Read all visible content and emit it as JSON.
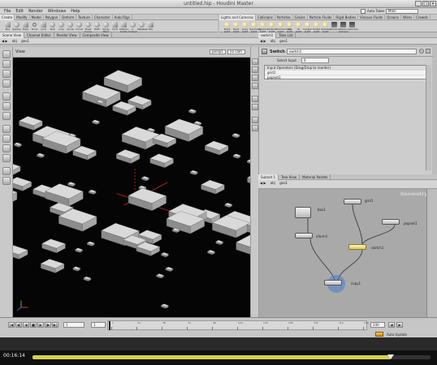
{
  "window": {
    "title": "untitled.hip - Houdini Master"
  },
  "menu": [
    "File",
    "Edit",
    "Render",
    "Windows",
    "Help"
  ],
  "menu_right": {
    "checkbox_label": "Auto Takes",
    "field_value": "Main"
  },
  "shelf_tabs_left": [
    "Create",
    "Modify",
    "Model",
    "Polygon",
    "Deform",
    "Texture",
    "Character",
    "Auto Rigs"
  ],
  "shelf_tabs_right": [
    "Lights and Cameras",
    "Collisions",
    "Particles",
    "Grains",
    "Particle Fluids",
    "Rigid Bodies",
    "Viscous Fluids",
    "Oceans",
    "Wires",
    "Crowds",
    "Drive Simulation"
  ],
  "shelf_tools_left": [
    {
      "label": "Box",
      "icon": "box-tool-icon",
      "shape": "cube"
    },
    {
      "label": "Sphere",
      "icon": "sphere-tool-icon",
      "shape": "sphere"
    },
    {
      "label": "Tube",
      "icon": "tube-tool-icon",
      "shape": "cube"
    },
    {
      "label": "Torus",
      "icon": "torus-tool-icon",
      "shape": "tor"
    },
    {
      "label": "Grid",
      "icon": "grid-tool-icon",
      "shape": "cube"
    },
    {
      "label": "Null",
      "icon": "null-tool-icon",
      "shape": "sphere"
    },
    {
      "label": "Line",
      "icon": "line-tool-icon",
      "shape": "sphere"
    },
    {
      "label": "Circle",
      "icon": "circle-tool-icon",
      "shape": "sphere"
    },
    {
      "label": "Curve",
      "icon": "curve-tool-icon",
      "shape": "sphere"
    },
    {
      "label": "Draw Curve",
      "icon": "draw-curve-tool-icon",
      "shape": "sphere"
    },
    {
      "label": "Path",
      "icon": "path-tool-icon",
      "shape": "sphere"
    },
    {
      "label": "Spray Paint",
      "icon": "spray-paint-tool-icon",
      "shape": "sphere"
    },
    {
      "label": "Font",
      "icon": "font-tool-icon",
      "shape": "cube"
    },
    {
      "label": "Platonic Solids",
      "icon": "platonic-tool-icon",
      "shape": "cube"
    },
    {
      "label": "L-System",
      "icon": "lsystem-tool-icon",
      "shape": "sphere"
    },
    {
      "label": "Metaball",
      "icon": "metaball-tool-icon",
      "shape": "sphere"
    },
    {
      "label": "File",
      "icon": "file-tool-icon",
      "shape": "cube"
    }
  ],
  "shelf_tools_right": [
    {
      "label": "Point Light",
      "icon": "point-light-icon",
      "shape": "lit"
    },
    {
      "label": "Spot Light",
      "icon": "spot-light-icon",
      "shape": "lit"
    },
    {
      "label": "Area Light",
      "icon": "area-light-icon",
      "shape": "lit"
    },
    {
      "label": "Geometry Light",
      "icon": "geometry-light-icon",
      "shape": "lit"
    },
    {
      "label": "Volume Light",
      "icon": "volume-light-icon",
      "shape": "lit"
    },
    {
      "label": "Distant Light",
      "icon": "distant-light-icon",
      "shape": "lit"
    },
    {
      "label": "Environment Light",
      "icon": "env-light-icon",
      "shape": "lit"
    },
    {
      "label": "Sky Light",
      "icon": "sky-light-icon",
      "shape": "lit"
    },
    {
      "label": "GI Light",
      "icon": "gi-light-icon",
      "shape": "lit"
    },
    {
      "label": "Caustic Light",
      "icon": "caustic-light-icon",
      "shape": "lit"
    },
    {
      "label": "Portal Light",
      "icon": "portal-light-icon",
      "shape": "lit"
    },
    {
      "label": "Ambient Light",
      "icon": "ambient-light-icon",
      "shape": "lit"
    },
    {
      "label": "Camera",
      "icon": "camera-tool-icon",
      "shape": "cam"
    },
    {
      "label": "Stereo Camera",
      "icon": "stereo-camera-icon",
      "shape": "cam"
    },
    {
      "label": "Switcher",
      "icon": "switcher-tool-icon",
      "shape": "cam"
    }
  ],
  "left_pane": {
    "tabs": [
      "Scene View",
      "Channel Editor",
      "Render View",
      "Composite View"
    ],
    "path": [
      "obj",
      "geo1"
    ],
    "view_label": "View",
    "persp_menu": "persp1",
    "cam_menu": "no cam"
  },
  "params": {
    "tabs": [
      "switch1",
      "Take List"
    ],
    "path": [
      "obj",
      "geo1"
    ],
    "node_type": "Switch",
    "node_name": "switch1",
    "select_input_label": "Select Input",
    "select_input_value": "0",
    "list_header": "Input Operators (Drag/Drop to reorder)",
    "inputs": [
      "grid1",
      "popnet1"
    ]
  },
  "network": {
    "tabs": [
      "Subnet 1",
      "Tree View",
      "Material Palette"
    ],
    "path": [
      "obj",
      "geo1"
    ],
    "context_label": "Geometry",
    "nodes": [
      {
        "name": "grid1",
        "selected": false
      },
      {
        "name": "box1",
        "selected": false
      },
      {
        "name": "popnet1",
        "selected": false
      },
      {
        "name": "xform1",
        "selected": false
      },
      {
        "name": "switch1",
        "selected": true
      },
      {
        "name": "copy1",
        "selected": false
      }
    ]
  },
  "timeline": {
    "current_frame": "1",
    "start_frame": "1",
    "end_frame": "240",
    "tick_labels": [
      "1",
      "24",
      "48",
      "72",
      "96",
      "120",
      "144",
      "168",
      "192",
      "216",
      "240"
    ],
    "auto_update": "Auto Update"
  },
  "player": {
    "time": "00:16:14",
    "progress": 0.9
  },
  "scene": {
    "grid_instances": 56,
    "highlight_color": "#cc2222"
  }
}
